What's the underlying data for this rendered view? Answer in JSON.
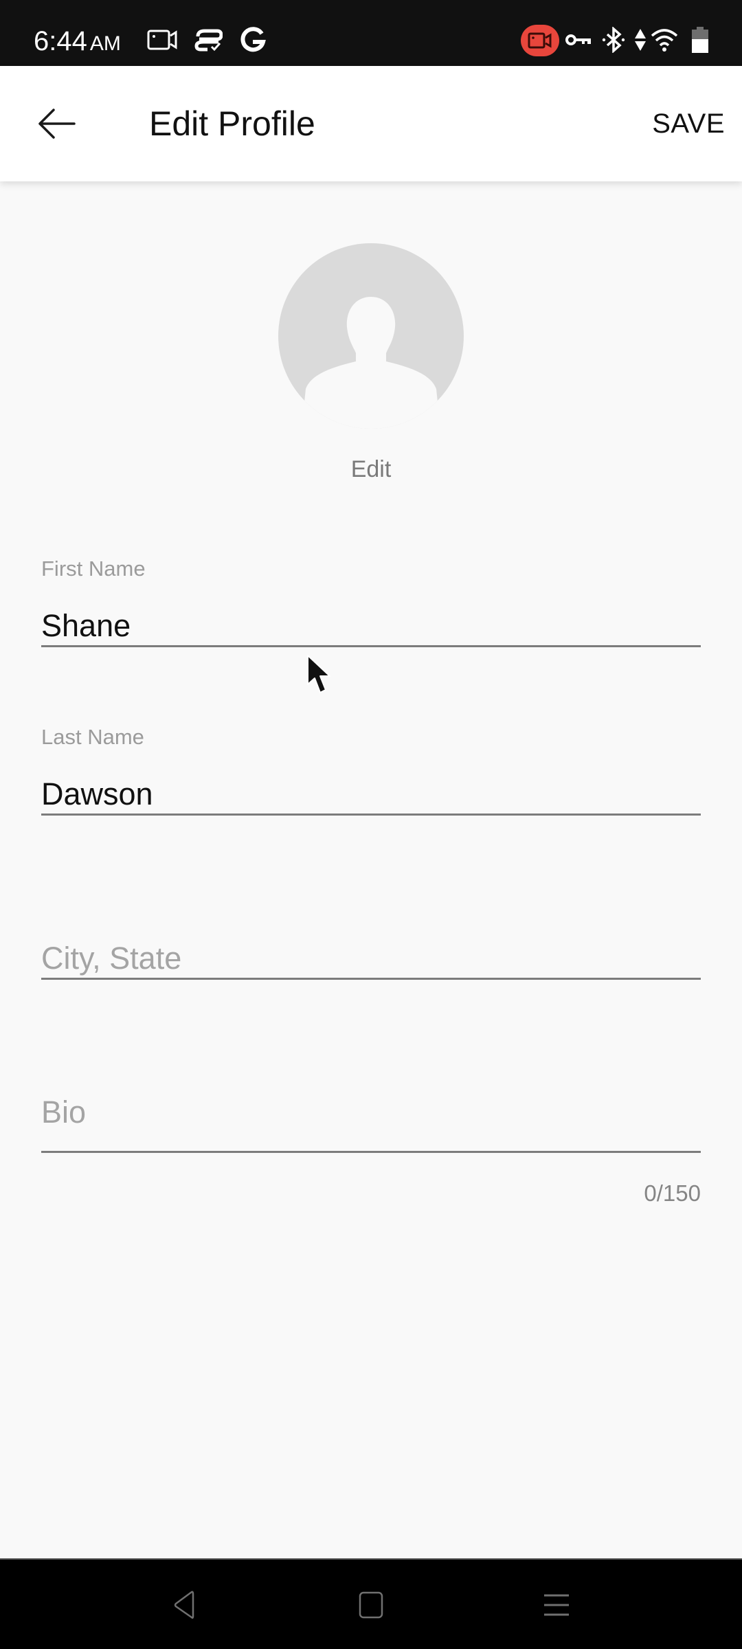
{
  "status_bar": {
    "time": "6:44",
    "ampm": "AM",
    "left_icons": [
      "screen-record-icon",
      "cloud-sync-icon",
      "google-icon"
    ],
    "right_icons": [
      "recording-indicator-icon",
      "vpn-key-icon",
      "bluetooth-icon",
      "data-arrows-icon",
      "wifi-icon",
      "battery-icon"
    ],
    "recording_color": "#e8463c"
  },
  "app_bar": {
    "title": "Edit Profile",
    "save_label": "SAVE",
    "back_icon": "arrow-left-icon"
  },
  "profile_photo": {
    "edit_label": "Edit"
  },
  "form": {
    "first_name": {
      "label": "First Name",
      "value": "Shane"
    },
    "last_name": {
      "label": "Last Name",
      "value": "Dawson"
    },
    "city_state": {
      "placeholder": "City, State",
      "value": ""
    },
    "bio": {
      "placeholder": "Bio",
      "value": "",
      "counter": "0/150"
    }
  },
  "nav_bar": {
    "buttons": [
      "back-triangle-icon",
      "home-square-icon",
      "menu-lines-icon"
    ]
  }
}
